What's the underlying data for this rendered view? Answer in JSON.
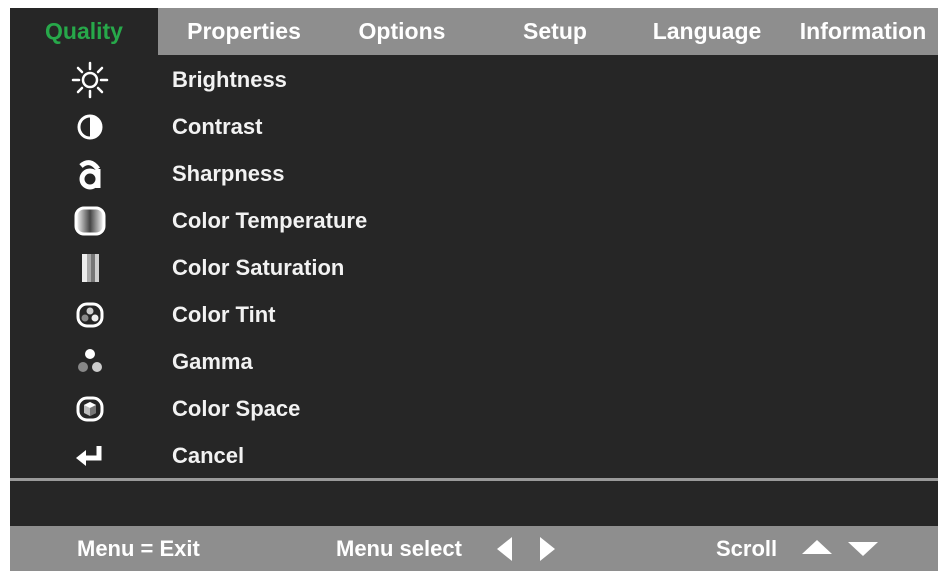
{
  "tabs": [
    {
      "label": "Quality",
      "active": true
    },
    {
      "label": "Properties"
    },
    {
      "label": "Options"
    },
    {
      "label": "Setup"
    },
    {
      "label": "Language"
    },
    {
      "label": "Information"
    }
  ],
  "menu": {
    "items": [
      {
        "label": "Brightness",
        "icon": "sun-icon"
      },
      {
        "label": "Contrast",
        "icon": "half-circle-icon"
      },
      {
        "label": "Sharpness",
        "icon": "letter-a-icon"
      },
      {
        "label": "Color Temperature",
        "icon": "rounded-square-icon"
      },
      {
        "label": "Color Saturation",
        "icon": "gradient-bars-icon"
      },
      {
        "label": "Color Tint",
        "icon": "tint-dots-icon"
      },
      {
        "label": "Gamma",
        "icon": "gamma-dots-icon"
      },
      {
        "label": "Color Space",
        "icon": "color-space-icon"
      },
      {
        "label": "Cancel",
        "icon": "return-arrow-icon"
      }
    ]
  },
  "footer": {
    "exit_label": "Menu = Exit",
    "select_label": "Menu select",
    "scroll_label": "Scroll"
  },
  "colors": {
    "active_tab_text": "#27a84a",
    "bar_background": "#8e8e8e",
    "panel_background": "#262626"
  }
}
